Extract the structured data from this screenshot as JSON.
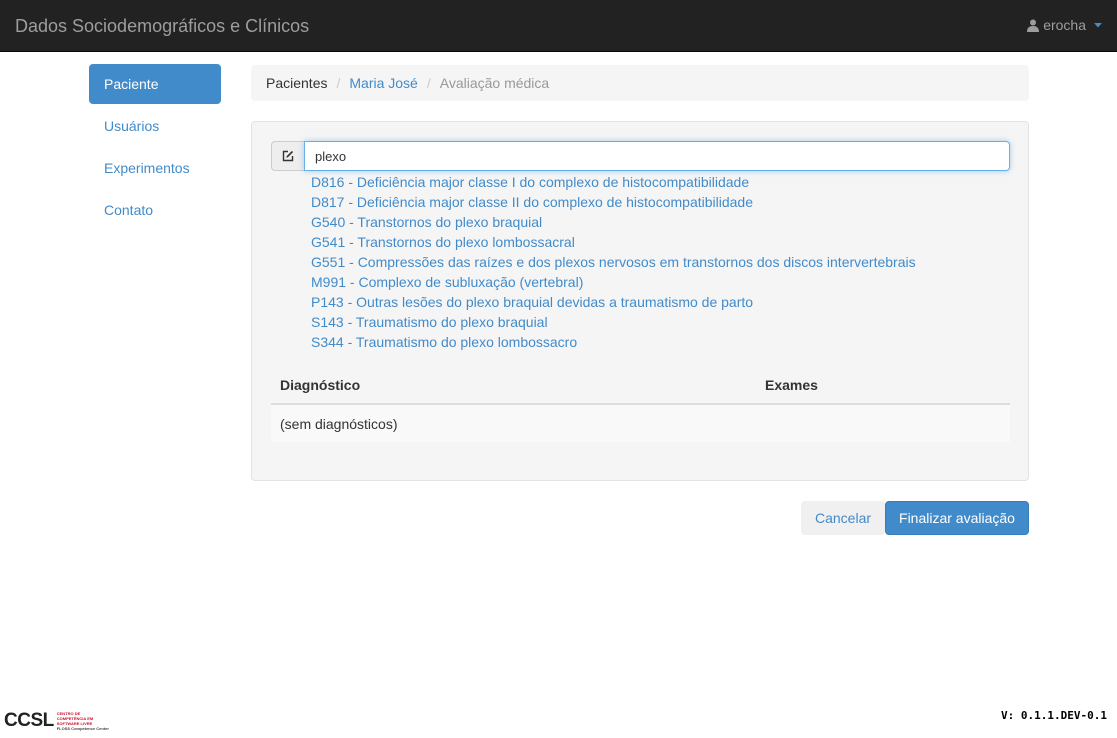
{
  "header": {
    "brand": "Dados Sociodemográficos e Clínicos",
    "user": "erocha",
    "user_icon": "user-icon",
    "caret_icon": "caret-down-icon"
  },
  "sidebar": {
    "items": [
      {
        "label": "Paciente",
        "active": true
      },
      {
        "label": "Usuários",
        "active": false
      },
      {
        "label": "Experimentos",
        "active": false
      },
      {
        "label": "Contato",
        "active": false
      }
    ]
  },
  "breadcrumb": {
    "items": [
      "Pacientes",
      "Maria José",
      "Avaliação médica"
    ],
    "separator": "/"
  },
  "search": {
    "icon": "edit-icon",
    "value": "plexo"
  },
  "suggestions": [
    "D816 - Deficiência major classe I do complexo de histocompatibilidade",
    "D817 - Deficiência major classe II do complexo de histocompatibilidade",
    "G540 - Transtornos do plexo braquial",
    "G541 - Transtornos do plexo lombossacral",
    "G551 - Compressões das raízes e dos plexos nervosos em transtornos dos discos intervertebrais",
    "M991 - Complexo de subluxação (vertebral)",
    "P143 - Outras lesões do plexo braquial devidas a traumatismo de parto",
    "S143 - Traumatismo do plexo braquial",
    "S344 - Traumatismo do plexo lombossacro"
  ],
  "table": {
    "headers": [
      "Diagnóstico",
      "Exames"
    ],
    "empty": "(sem diagnósticos)"
  },
  "actions": {
    "cancel": "Cancelar",
    "finish": "Finalizar avaliação"
  },
  "footer": {
    "logo": "CCSL",
    "logo_sub": [
      "CENTRO DE",
      "COMPETÊNCIA EM",
      "SOFTWARE LIVRE",
      "FLOSS Competence Center"
    ],
    "version": "V: 0.1.1.DEV-0.1"
  },
  "colors": {
    "navbar": "#222222",
    "accent": "#428bca",
    "well": "#f5f5f5"
  }
}
